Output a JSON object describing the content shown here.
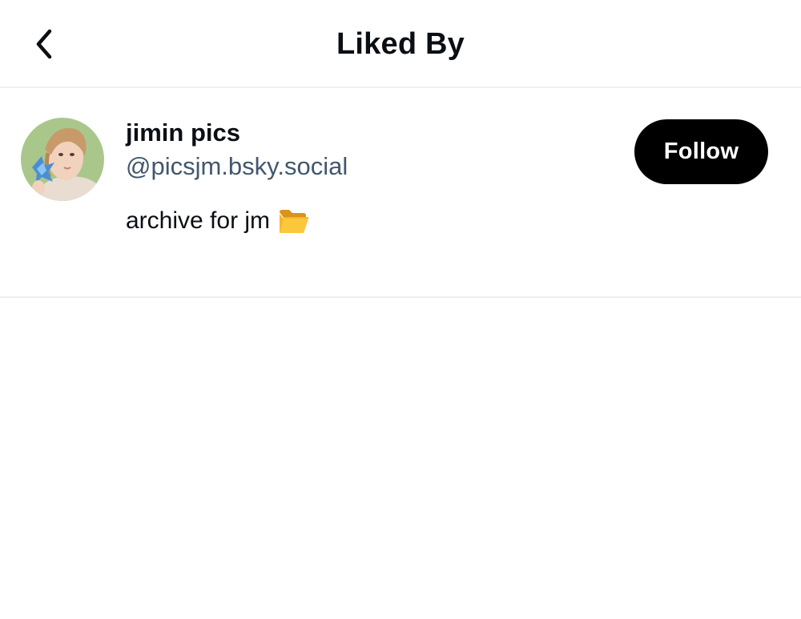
{
  "header": {
    "title": "Liked By",
    "back_icon": "chevron-left-icon"
  },
  "users": [
    {
      "display_name": "jimin pics",
      "handle": "@picsjm.bsky.social",
      "bio": "archive for jm",
      "bio_emoji_icon": "open-folder-icon",
      "follow_label": "Follow"
    }
  ],
  "colors": {
    "text_primary": "#0b0f14",
    "text_secondary": "#43576d",
    "follow_bg": "#000000",
    "follow_text": "#ffffff",
    "divider": "#eef1f4"
  }
}
